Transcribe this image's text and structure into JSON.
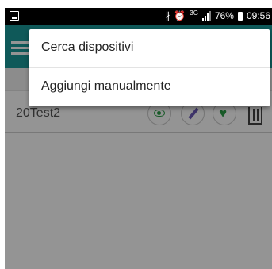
{
  "status_bar": {
    "left_icon": "image-notification-icon",
    "bluetooth_icon": "bluetooth-icon",
    "alarm_icon": "alarm-icon",
    "network_label": "3G",
    "signal_icon": "signal-icon",
    "battery_percent": "76%",
    "battery_icon": "battery-icon",
    "time": "09:56"
  },
  "app_bar": {
    "menu_icon": "hamburger-menu-icon",
    "color": "#1a9a9a"
  },
  "device_list": [
    {
      "name": "20Test2",
      "actions": [
        "eye-icon",
        "pencil-icon",
        "heart-icon",
        "trash-icon"
      ]
    }
  ],
  "overflow_menu": {
    "items": [
      {
        "label": "Cerca dispositivi"
      },
      {
        "label": "Aggiungi manualmente"
      }
    ]
  }
}
